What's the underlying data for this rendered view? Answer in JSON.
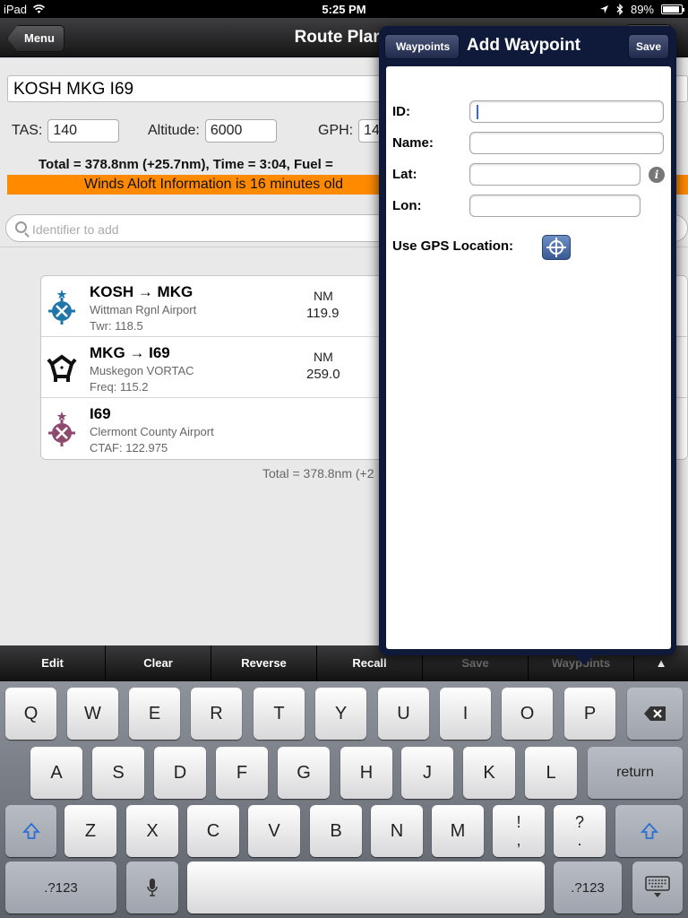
{
  "status": {
    "device": "iPad",
    "time": "5:25 PM",
    "battery": "89%"
  },
  "nav": {
    "back_label": "Menu",
    "title": "Route Plann"
  },
  "route": {
    "text": "KOSH MKG I69"
  },
  "params": {
    "tas_label": "TAS:",
    "tas_value": "140",
    "alt_label": "Altitude:",
    "alt_value": "6000",
    "gph_label": "GPH:",
    "gph_value": "14"
  },
  "totals": "Total = 378.8nm (+25.7nm), Time = 3:04, Fuel =",
  "winds": "Winds Aloft Information is 16 minutes old",
  "search": {
    "placeholder": "Identifier to add"
  },
  "legs": [
    {
      "name": "KOSH → MKG",
      "sub1": "Wittman Rgnl Airport",
      "sub2": "Twr: 118.5",
      "unit": "NM",
      "dist": "119.9",
      "icon": "towered-airport-icon"
    },
    {
      "name": "MKG → I69",
      "sub1": "Muskegon VORTAC",
      "sub2": "Freq: 115.2",
      "unit": "NM",
      "dist": "259.0",
      "icon": "vortac-icon"
    },
    {
      "name": "I69",
      "sub1": "Clermont County Airport",
      "sub2": "CTAF: 122.975",
      "unit": "",
      "dist": "",
      "icon": "nontowered-airport-icon"
    }
  ],
  "route_total": "Total = 378.8nm (+2",
  "toolbar": {
    "edit": "Edit",
    "clear": "Clear",
    "reverse": "Reverse",
    "recall": "Recall",
    "save": "Save",
    "waypoints": "Waypoints",
    "up": "▲"
  },
  "popover": {
    "back_label": "Waypoints",
    "title": "Add Waypoint",
    "save_label": "Save",
    "id_label": "ID:",
    "name_label": "Name:",
    "lat_label": "Lat:",
    "lon_label": "Lon:",
    "gps_label": "Use GPS Location:"
  },
  "keyboard": {
    "row1": [
      "Q",
      "W",
      "E",
      "R",
      "T",
      "Y",
      "U",
      "I",
      "O",
      "P"
    ],
    "row2": [
      "A",
      "S",
      "D",
      "F",
      "G",
      "H",
      "J",
      "K",
      "L"
    ],
    "row3": [
      "Z",
      "X",
      "C",
      "V",
      "B",
      "N",
      "M"
    ],
    "return": "return",
    "num": ".?123",
    "excl_top": "!",
    "excl_bottom": ",",
    "q_top": "?",
    "q_bottom": "."
  },
  "colors": {
    "winds_banner": "#ff8a00",
    "popover_frame": "#0f1a3a",
    "airport_blue": "#1f76a8",
    "airport_magenta": "#8e4a6e"
  }
}
